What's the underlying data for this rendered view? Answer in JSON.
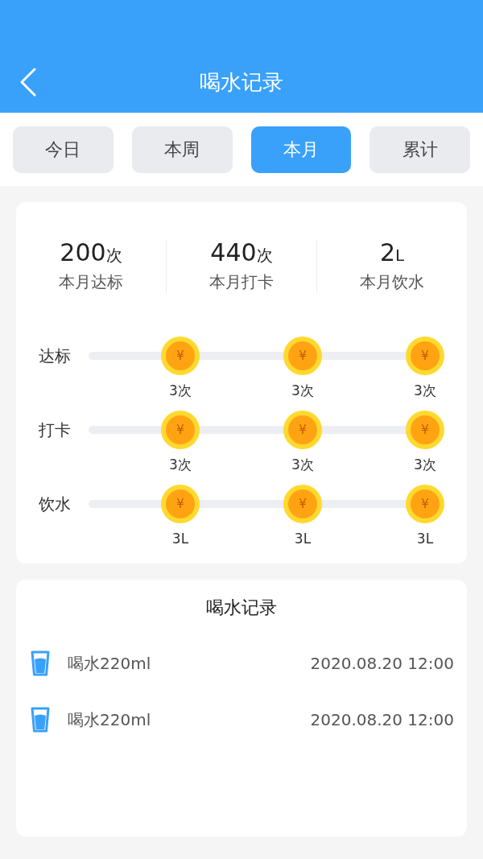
{
  "header": {
    "title": "喝水记录"
  },
  "tabs": [
    {
      "label": "今日",
      "selected": false
    },
    {
      "label": "本周",
      "selected": false
    },
    {
      "label": "本月",
      "selected": true
    },
    {
      "label": "累计",
      "selected": false
    }
  ],
  "stats": [
    {
      "value": "200",
      "unit": "次",
      "label": "本月达标"
    },
    {
      "value": "440",
      "unit": "次",
      "label": "本月打卡"
    },
    {
      "value": "2",
      "unit": "L",
      "label": "本月饮水"
    }
  ],
  "reward_rows": [
    {
      "label": "达标",
      "coins": [
        {
          "symbol": "¥",
          "caption": "3次"
        },
        {
          "symbol": "¥",
          "caption": "3次"
        },
        {
          "symbol": "¥",
          "caption": "3次"
        }
      ]
    },
    {
      "label": "打卡",
      "coins": [
        {
          "symbol": "¥",
          "caption": "3次"
        },
        {
          "symbol": "¥",
          "caption": "3次"
        },
        {
          "symbol": "¥",
          "caption": "3次"
        }
      ]
    },
    {
      "label": "饮水",
      "coins": [
        {
          "symbol": "¥",
          "caption": "3L"
        },
        {
          "symbol": "¥",
          "caption": "3L"
        },
        {
          "symbol": "¥",
          "caption": "3L"
        }
      ]
    }
  ],
  "records": {
    "title": "喝水记录",
    "items": [
      {
        "text": "喝水220ml",
        "time": "2020.08.20 12:00"
      },
      {
        "text": "喝水220ml",
        "time": "2020.08.20 12:00"
      }
    ]
  }
}
